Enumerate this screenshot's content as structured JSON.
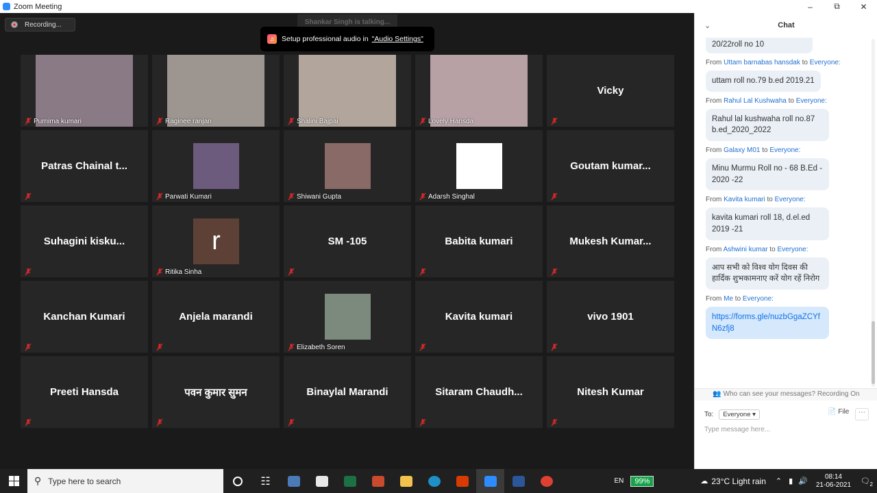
{
  "window": {
    "title": "Zoom Meeting"
  },
  "meeting": {
    "recording_label": "Recording...",
    "talking_label": "Shankar Singh is talking...",
    "toast_text": "Setup professional audio in",
    "toast_link": "\"Audio Settings\""
  },
  "participants": [
    {
      "name": "Purnima kumari",
      "kind": "video",
      "color": "#8a7a86"
    },
    {
      "name": "Raginee ranjan",
      "kind": "video",
      "color": "#9c9590"
    },
    {
      "name": "Shalini Bajpai",
      "kind": "video",
      "color": "#b2a59c"
    },
    {
      "name": "Lovely Hansda",
      "kind": "video",
      "color": "#b7a1a4"
    },
    {
      "name": "Vicky",
      "kind": "name"
    },
    {
      "name": "Patras Chainal t...",
      "kind": "name"
    },
    {
      "name": "Parwati Kumari",
      "kind": "photo",
      "color": "#6d5b7e"
    },
    {
      "name": "Shiwani Gupta",
      "kind": "photo",
      "color": "#8a6a66"
    },
    {
      "name": "Adarsh Singhal",
      "kind": "photo",
      "color": "#ffffff"
    },
    {
      "name": "Goutam kumar...",
      "kind": "name"
    },
    {
      "name": "Suhagini kisku...",
      "kind": "name"
    },
    {
      "name": "Ritika Sinha",
      "kind": "letter",
      "letter": "r",
      "color": "#5e4136"
    },
    {
      "name": "SM -105",
      "kind": "name"
    },
    {
      "name": "Babita kumari",
      "kind": "name"
    },
    {
      "name": "Mukesh Kumar...",
      "kind": "name"
    },
    {
      "name": "Kanchan Kumari",
      "kind": "name"
    },
    {
      "name": "Anjela marandi",
      "kind": "name"
    },
    {
      "name": "Elizabeth Soren",
      "kind": "photo",
      "color": "#7c8a7e"
    },
    {
      "name": "Kavita kumari",
      "kind": "name"
    },
    {
      "name": "vivo 1901",
      "kind": "name"
    },
    {
      "name": "Preeti Hansda",
      "kind": "name"
    },
    {
      "name": "पवन कुमार सुमन",
      "kind": "name"
    },
    {
      "name": "Binaylal Marandi",
      "kind": "name"
    },
    {
      "name": "Sitaram Chaudh...",
      "kind": "name"
    },
    {
      "name": "Nitesh Kumar",
      "kind": "name"
    }
  ],
  "chat": {
    "title": "Chat",
    "prev_tail": "20/22roll no 10",
    "from_word": "From",
    "to_word": "to",
    "everyone": "Everyone:",
    "messages": [
      {
        "sender": "Uttam barnabas hansdak",
        "text": "uttam roll no.79 b.ed 2019.21"
      },
      {
        "sender": "Rahul Lal Kushwaha",
        "text": "Rahul lal kushwaha roll no.87 b.ed_2020_2022"
      },
      {
        "sender": "Galaxy M01",
        "text": "Minu Murmu Roll no - 68 B.Ed  - 2020 -22"
      },
      {
        "sender": "Kavita kumari",
        "text": "kavita kumari roll 18, d.el.ed 2019 -21"
      },
      {
        "sender": "Ashwini kumar",
        "text": "आप सभी को विश्व योग दिवस की हार्दिक शुभकामनाए करें योग रहें निरोग"
      },
      {
        "sender": "Me",
        "text": "https://forms.gle/nuzbGgaZCYfN6zfj8",
        "link": true
      }
    ],
    "notice": "Who can see your messages? Recording On",
    "to_label": "To:",
    "to_value": "Everyone",
    "file_label": "File",
    "placeholder": "Type message here..."
  },
  "taskbar": {
    "search_placeholder": "Type here to search",
    "lang": "EN",
    "battery": "99%",
    "weather": "23°C  Light rain",
    "time": "08:14",
    "date": "21-06-2021",
    "notifications": "2"
  },
  "colors": {
    "zoom_blue": "#2d8cff",
    "tile_bg": "#262626",
    "muted_red": "#e02828"
  }
}
